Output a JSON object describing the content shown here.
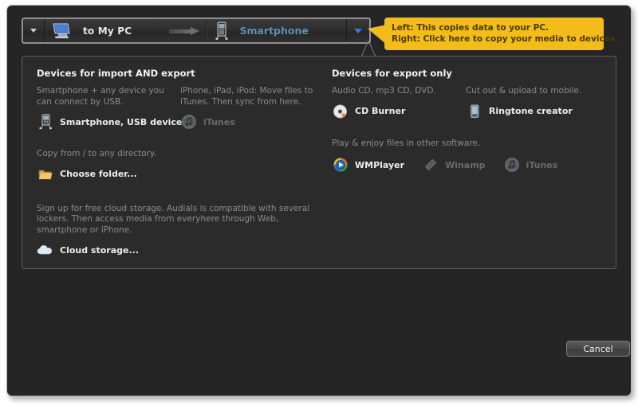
{
  "window": {
    "title": ""
  },
  "topbar": {
    "left_dropdown_icon": "caret-down-icon",
    "pc_icon": "monitor-icon",
    "pc_label": "to My PC",
    "arrow_icon": "arrow-right-icon",
    "device_icon": "smartphone-icon",
    "device_label": "Smartphone",
    "right_dropdown_icon": "caret-down-blue-icon"
  },
  "callout": {
    "line1": "Left: This copies data to your PC.",
    "line2": "Right: Click here to copy your media to devices.",
    "bg_color": "#f3bc19",
    "text_color": "#4a3a06"
  },
  "panel": {
    "left": {
      "section_title": "Devices for import AND export",
      "columns": [
        {
          "description": "Smartphone + any device you can connect by USB.",
          "item": {
            "label": "Smartphone, USB device",
            "icon": "smartphone-usb-icon",
            "disabled": false
          }
        },
        {
          "description": "iPhone, iPad, iPod: Move files to iTunes. Then sync from here.",
          "item": {
            "label": "iTunes",
            "icon": "itunes-icon",
            "disabled": true
          }
        }
      ],
      "folder_block": {
        "description": "Copy from / to any directory.",
        "item": {
          "label": "Choose folder...",
          "icon": "folder-icon",
          "disabled": false
        }
      },
      "cloud_block": {
        "description": "Sign up for free cloud storage. Audials is compatible with several lockers. Then access media from everyhere through Web, smartphone or iPhone.",
        "item": {
          "label": "Cloud storage...",
          "icon": "cloud-icon",
          "disabled": false
        }
      }
    },
    "right": {
      "section_title": "Devices for export only",
      "columns": [
        {
          "description": "Audio CD, mp3 CD, DVD.",
          "item": {
            "label": "CD Burner",
            "icon": "cd-burner-icon",
            "disabled": false
          }
        },
        {
          "description": "Cut out & upload to mobile.",
          "item": {
            "label": "Ringtone creator",
            "icon": "ringtone-icon",
            "disabled": false
          }
        }
      ],
      "players_block": {
        "description": "Play & enjoy files in other software.",
        "items": [
          {
            "label": "WMPlayer",
            "icon": "wmplayer-icon",
            "disabled": false
          },
          {
            "label": "Winamp",
            "icon": "winamp-icon",
            "disabled": true
          },
          {
            "label": "iTunes",
            "icon": "itunes-icon",
            "disabled": true
          }
        ]
      }
    }
  },
  "footer": {
    "cancel_label": "Cancel"
  },
  "colors": {
    "window_bg": "#252525",
    "panel_bg": "#2b2b2b",
    "accent_blue": "#5f8fb0",
    "callout_yellow": "#f3bc19",
    "muted_text": "#8c8c8c"
  }
}
